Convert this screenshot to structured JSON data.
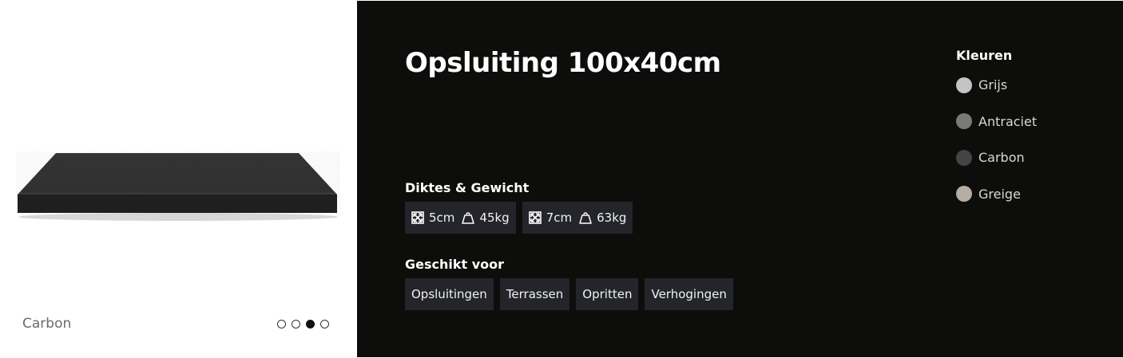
{
  "gallery": {
    "caption": "Carbon",
    "slide_count": 4,
    "active_slide": 3
  },
  "product": {
    "title": "Opsluiting 100x40cm"
  },
  "thickness_section": {
    "label": "Diktes & Gewicht",
    "options": [
      {
        "thickness": "5cm",
        "weight": "45kg",
        "thickness_icon": "dimensions-icon",
        "weight_icon": "weight-icon"
      },
      {
        "thickness": "7cm",
        "weight": "63kg",
        "thickness_icon": "dimensions-icon",
        "weight_icon": "weight-icon"
      }
    ]
  },
  "usage_section": {
    "label": "Geschikt voor",
    "items": [
      "Opsluitingen",
      "Terrassen",
      "Opritten",
      "Verhogingen"
    ]
  },
  "colors_section": {
    "label": "Kleuren",
    "items": [
      {
        "name": "Grijs",
        "color": "#c4c4c4"
      },
      {
        "name": "Antraciet",
        "color": "#7a7a78"
      },
      {
        "name": "Carbon",
        "color": "#444444"
      },
      {
        "name": "Greige",
        "color": "#b6ada2"
      }
    ]
  }
}
